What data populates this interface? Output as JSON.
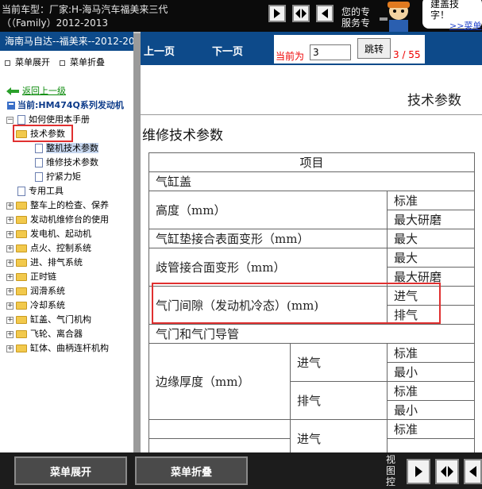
{
  "header": {
    "vehicle_line1": "当前车型：厂家:H-海马汽车福美来三代",
    "vehicle_line2": "（（Family）2012-2013",
    "msg_line1": "您的专",
    "msg_line2": "服务专",
    "bubble_line1": "建盖技",
    "bubble_line2": "字！",
    "bubble_link": ">>菜单"
  },
  "sidebar": {
    "title": "海南马自达--福美来--2012-2013",
    "expand_label": "菜单展开",
    "collapse_label": "菜单折叠",
    "back_label": "返回上一级",
    "current_label": "当前:HM474Q系列发动机",
    "items": [
      {
        "label": "如何使用本手册"
      },
      {
        "label": "技术参数"
      },
      {
        "label": "整机技术参数"
      },
      {
        "label": "维修技术参数"
      },
      {
        "label": "拧紧力矩"
      },
      {
        "label": "专用工具"
      },
      {
        "label": "整车上的检查、保养"
      },
      {
        "label": "发动机维修台的使用"
      },
      {
        "label": "发电机、起动机"
      },
      {
        "label": "点火、控制系统"
      },
      {
        "label": "进、排气系统"
      },
      {
        "label": "正时链"
      },
      {
        "label": "润滑系统"
      },
      {
        "label": "冷却系统"
      },
      {
        "label": "缸盖、气门机构"
      },
      {
        "label": "飞轮、离合器"
      },
      {
        "label": "缸体、曲柄连杆机构"
      }
    ]
  },
  "nav": {
    "prev_label": "上一页",
    "next_label": "下一页",
    "current_label": "当前为",
    "page_value": "3",
    "jump_label": "跳转",
    "page_count": "3 / 55"
  },
  "doc": {
    "header": "技术参数",
    "section_title": "维修技术参数",
    "table": {
      "header": "项目",
      "cylinder_head": "气缸盖",
      "height": "高度（mm）",
      "standard": "标准",
      "max_grind": "最大研磨",
      "gasket_warp": "气缸垫接合表面变形（mm）",
      "max": "最大",
      "manifold_warp": "歧管接合面变形（mm）",
      "max_grind_2": "最大研磨",
      "valve_clearance": "气门间隙（发动机冷态）(mm)",
      "intake": "进气",
      "exhaust": "排气",
      "valve_guide": "气门和气门导管",
      "margin_thickness": "边缘厚度（mm）",
      "min": "最小"
    }
  },
  "footer": {
    "expand_label": "菜单展开",
    "collapse_label": "菜单折叠",
    "view_label": "视图控"
  }
}
